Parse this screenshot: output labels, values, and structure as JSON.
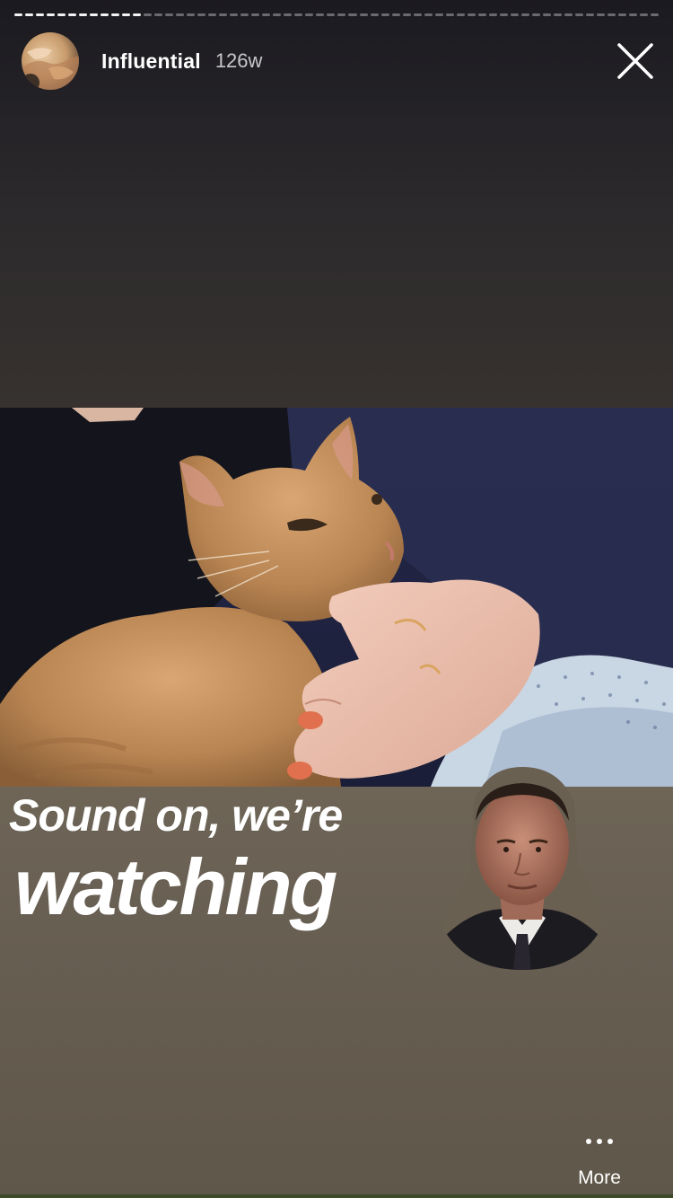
{
  "progress": {
    "total_segments": 60,
    "completed_segments": 12
  },
  "header": {
    "username": "Influential",
    "time_ago": "126w"
  },
  "caption": {
    "line1": "Sound on, we’re",
    "line2": "watching"
  },
  "footer": {
    "more_label": "More"
  },
  "icons": {
    "close": "close-icon",
    "more": "more-dots-icon"
  }
}
